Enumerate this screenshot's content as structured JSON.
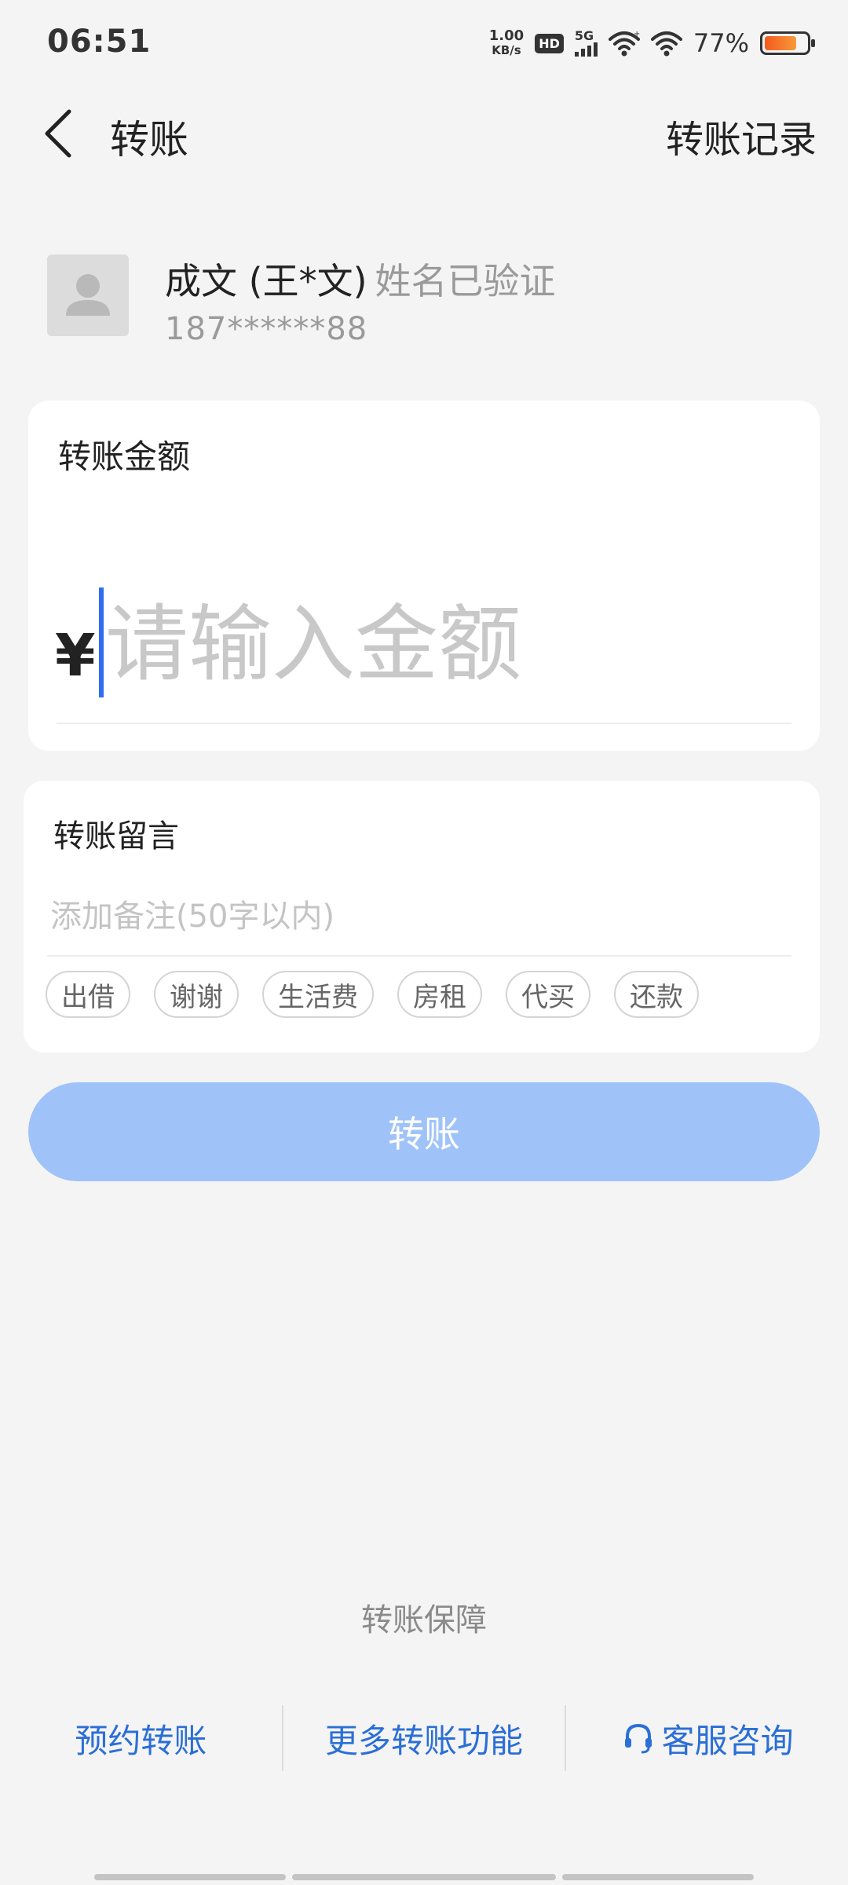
{
  "status_bar": {
    "time": "06:51",
    "net_speed_value": "1.00",
    "net_speed_unit": "KB/s",
    "hd_label": "HD",
    "signal_label": "5G",
    "battery_percent": "77%",
    "battery_level": 0.77,
    "battery_color": "#f45a1e"
  },
  "header": {
    "title": "转账",
    "records_label": "转账记录"
  },
  "recipient": {
    "name": "成文 (王*文)",
    "verified_text": "姓名已验证",
    "phone": "187******88"
  },
  "amount_card": {
    "label": "转账金额",
    "currency_symbol": "¥",
    "value": "",
    "placeholder": "请输入金额"
  },
  "remark_card": {
    "label": "转账留言",
    "value": "",
    "placeholder": "添加备注(50字以内)",
    "tags": [
      "出借",
      "谢谢",
      "生活费",
      "房租",
      "代买",
      "还款"
    ]
  },
  "transfer_button": {
    "label": "转账",
    "color": "#9fc3f8"
  },
  "footer": {
    "guarantee": "转账保障",
    "links": [
      {
        "label": "预约转账"
      },
      {
        "label": "更多转账功能"
      },
      {
        "label": "客服咨询",
        "icon": "headset-icon"
      }
    ],
    "link_color": "#2b6fd6"
  }
}
